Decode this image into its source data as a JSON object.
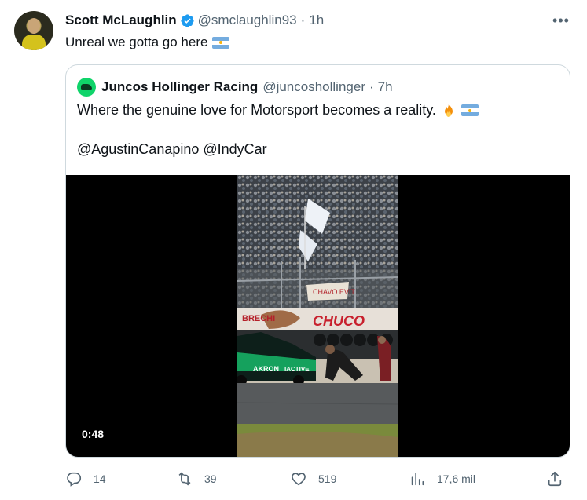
{
  "tweet": {
    "author_name": "Scott McLaughlin",
    "author_handle": "@smclaughlin93",
    "separator": "·",
    "time": "1h",
    "text": "Unreal we gotta go here",
    "text_emoji": "argentina-flag"
  },
  "quoted": {
    "author_name": "Juncos Hollinger Racing",
    "author_handle": "@juncoshollinger",
    "separator": "·",
    "time": "7h",
    "line1": "Where the genuine love for Motorsport becomes a reality.",
    "line1_emojis": [
      "fire",
      "argentina-flag"
    ],
    "line2": "@AgustinCanapino @IndyCar",
    "video": {
      "duration": "0:48",
      "banner_texts": [
        "CHUCO",
        "BRECHI",
        "CHAVO EVIT"
      ],
      "car_texts": [
        "AKRON",
        "IACTIVE"
      ]
    }
  },
  "actions": {
    "reply_count": "14",
    "retweet_count": "39",
    "like_count": "519",
    "views_count": "17,6 mil"
  },
  "colors": {
    "verified": "#1d9bf0",
    "muted": "#536471",
    "text": "#0f1419",
    "border": "#cfd9de"
  }
}
